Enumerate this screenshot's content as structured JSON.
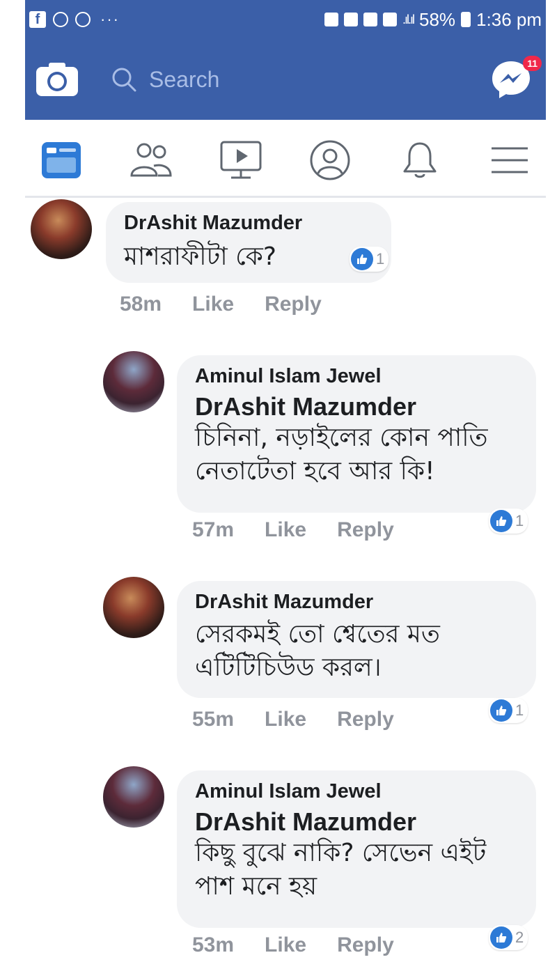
{
  "status_bar": {
    "battery": "58%",
    "time": "1:36 pm"
  },
  "header": {
    "search_placeholder": "Search",
    "messenger_badge": "11"
  },
  "tabs": [
    {
      "name": "news-feed",
      "icon": "news-feed-icon",
      "active": true
    },
    {
      "name": "friends",
      "icon": "friends-icon",
      "active": false
    },
    {
      "name": "watch",
      "icon": "watch-icon",
      "active": false
    },
    {
      "name": "profile",
      "icon": "profile-icon",
      "active": false
    },
    {
      "name": "notifications",
      "icon": "bell-icon",
      "active": false
    },
    {
      "name": "menu",
      "icon": "menu-icon",
      "active": false
    }
  ],
  "comments": [
    {
      "author": "DrAshit Mazumder",
      "mention": "",
      "text": "মাশরাফীটা কে?",
      "time": "58m",
      "like_label": "Like",
      "reply_label": "Reply",
      "reactions": "1"
    },
    {
      "author": "Aminul Islam Jewel",
      "mention": "DrAshit Mazumder",
      "text": "চিনিনা, নড়াইলের কোন পাতি নেতাটেতা হবে আর কি!",
      "time": "57m",
      "like_label": "Like",
      "reply_label": "Reply",
      "reactions": "1"
    },
    {
      "author": "DrAshit Mazumder",
      "mention": "",
      "text": "সেরকমই তো শ্বেতের মত এটিটিচিউড করল।",
      "time": "55m",
      "like_label": "Like",
      "reply_label": "Reply",
      "reactions": "1"
    },
    {
      "author": "Aminul Islam Jewel",
      "mention": "DrAshit Mazumder",
      "text": "কিছু বুঝে নাকি? সেভেন এইট পাশ মনে হয়",
      "time": "53m",
      "like_label": "Like",
      "reply_label": "Reply",
      "reactions": "2"
    }
  ],
  "colors": {
    "brand_blue": "#3b5fa8",
    "like_blue": "#2d7ad6",
    "bubble_bg": "#f2f3f5",
    "meta_gray": "#90949c"
  }
}
